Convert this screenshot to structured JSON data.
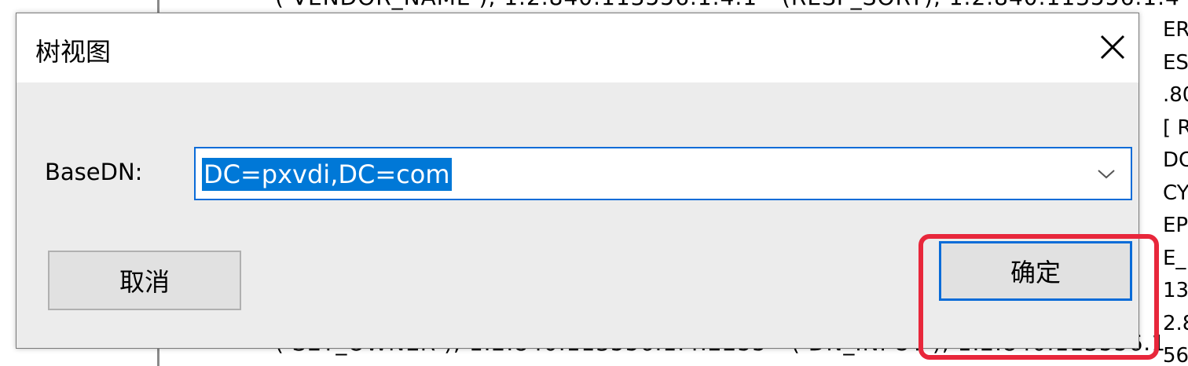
{
  "background": {
    "top_text": "( VENDOR_NAME ), 1.2.840.113556.1.4.1 - (RESP_SORT), 1.2.840.113556.1.4",
    "bottom_text": "( SET_OWNER ), 1.2.840.113556.1.4.2255 - ( DN_INPUT ), 1.2.840.113556.1",
    "right_column": [
      "ER",
      "ES",
      ".80",
      "[ R",
      "DC",
      "CY",
      "EP",
      "E_",
      "13",
      "2.8",
      "56."
    ]
  },
  "dialog": {
    "title": "树视图",
    "close_label": "×",
    "basedn_label": "BaseDN:",
    "basedn_value": "DC=pxvdi,DC=com",
    "cancel_label": "取消",
    "ok_label": "确定"
  },
  "colors": {
    "selection": "#0078d7",
    "focus_border": "#0a6cd8",
    "highlight": "#e8273b"
  }
}
